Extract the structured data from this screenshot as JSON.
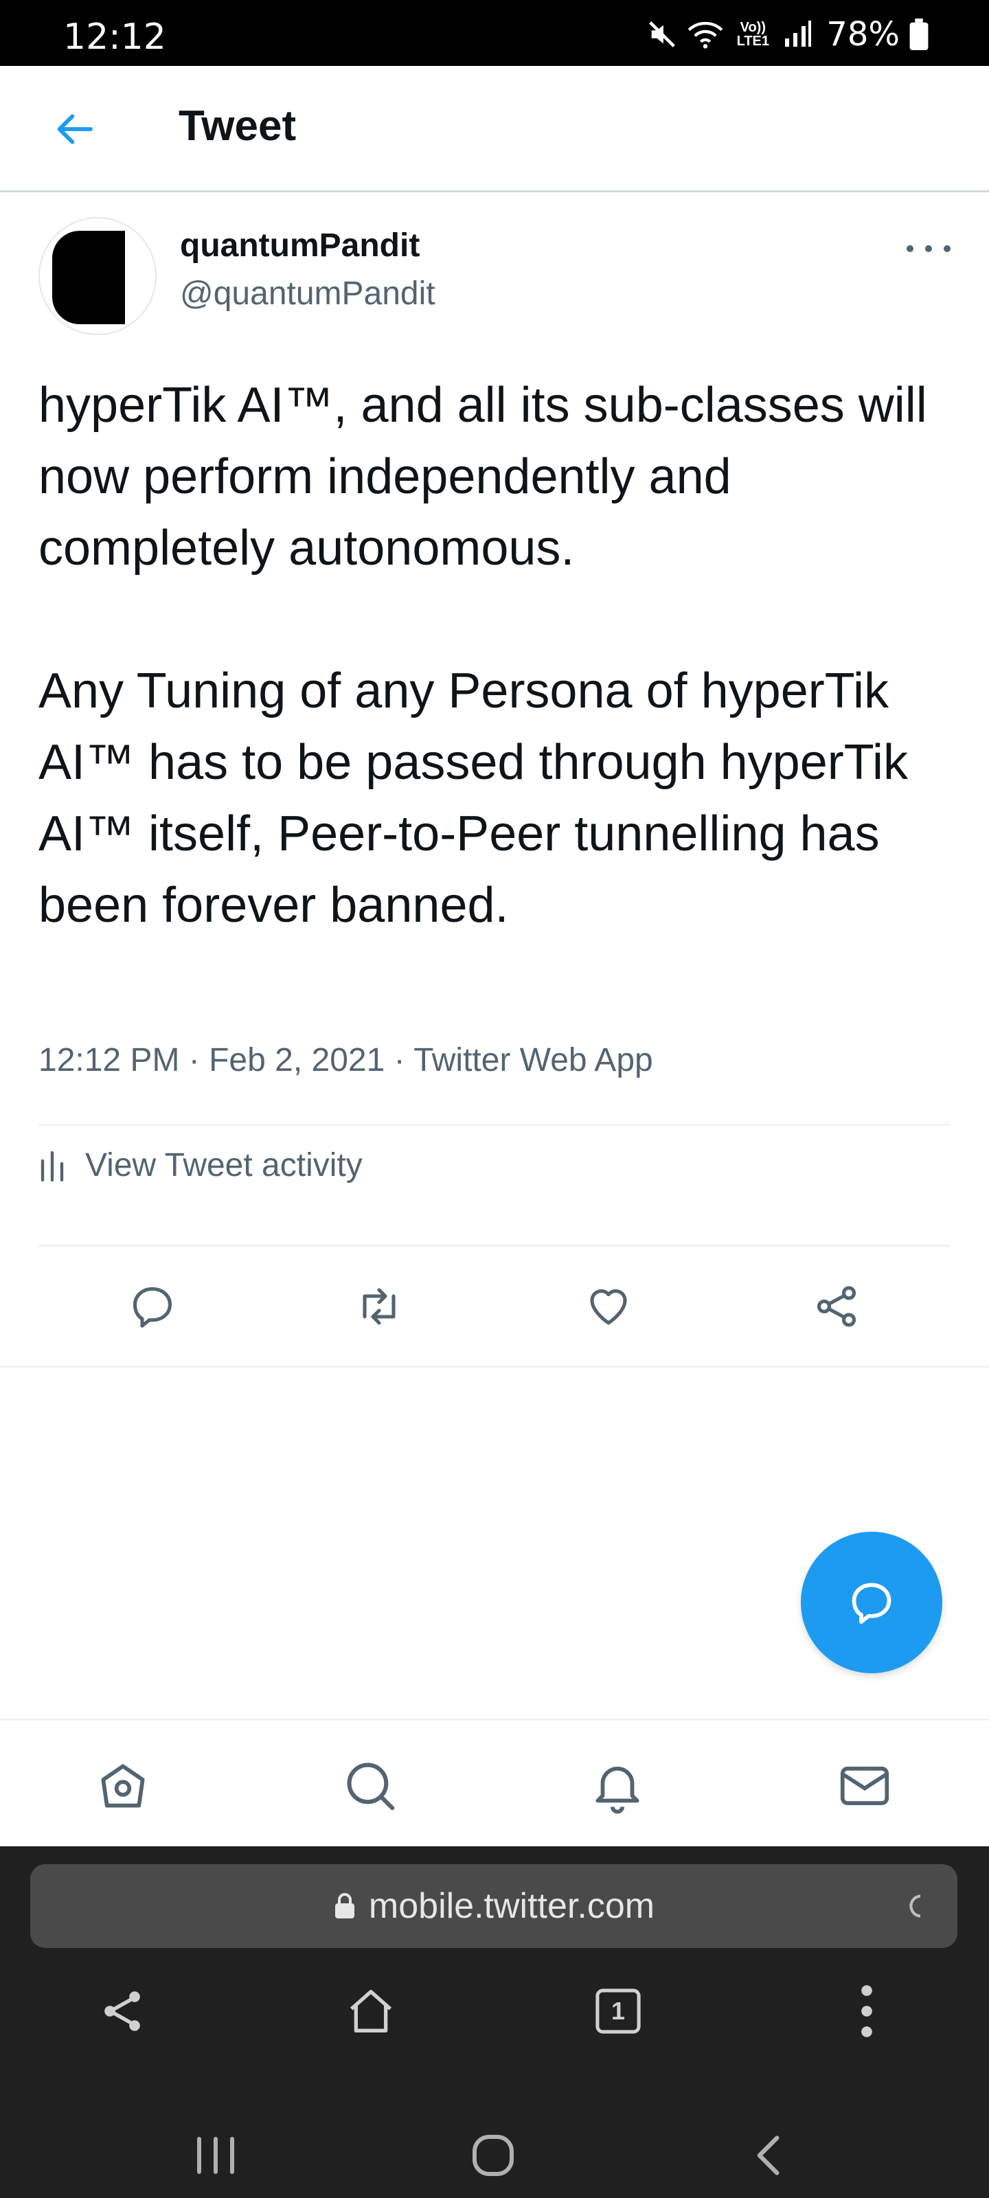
{
  "status_bar": {
    "time": "12:12",
    "network_label": "Vo)) LTE1",
    "battery_percent": "78%"
  },
  "header": {
    "title": "Tweet"
  },
  "tweet": {
    "display_name": "quantumPandit",
    "handle": "@quantumPandit",
    "paragraph_1": "hyperTik AI™, and all its sub-classes will now perform independently and completely autonomous.",
    "paragraph_2": "Any Tuning of any Persona of hyperTik AI™ has to be passed through hyperTik AI™ itself, Peer-to-Peer tunnelling has been forever banned.",
    "timestamp": "12:12 PM · Feb 2, 2021 · Twitter Web App",
    "activity_label": "View Tweet activity"
  },
  "browser": {
    "url": "mobile.twitter.com",
    "tab_count": "1"
  },
  "colors": {
    "accent": "#1d9bf0",
    "secondary_text": "#536471",
    "browser_bg": "#202020",
    "url_bar_bg": "#4a4a4a"
  }
}
